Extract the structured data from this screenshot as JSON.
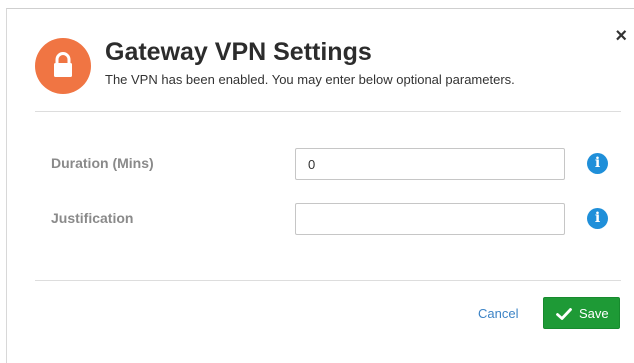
{
  "dialog": {
    "title": "Gateway VPN Settings",
    "subtitle": "The VPN has been enabled. You may enter below optional parameters.",
    "close_label": "×",
    "header_icon": "lock-icon",
    "accent_color": "#f07543"
  },
  "form": {
    "duration": {
      "label": "Duration (Mins)",
      "value": "0",
      "info_icon": "info-icon"
    },
    "justification": {
      "label": "Justification",
      "value": "",
      "info_icon": "info-icon"
    }
  },
  "footer": {
    "cancel_label": "Cancel",
    "save_label": "Save",
    "save_icon": "check-icon",
    "save_color": "#1e9a36"
  }
}
